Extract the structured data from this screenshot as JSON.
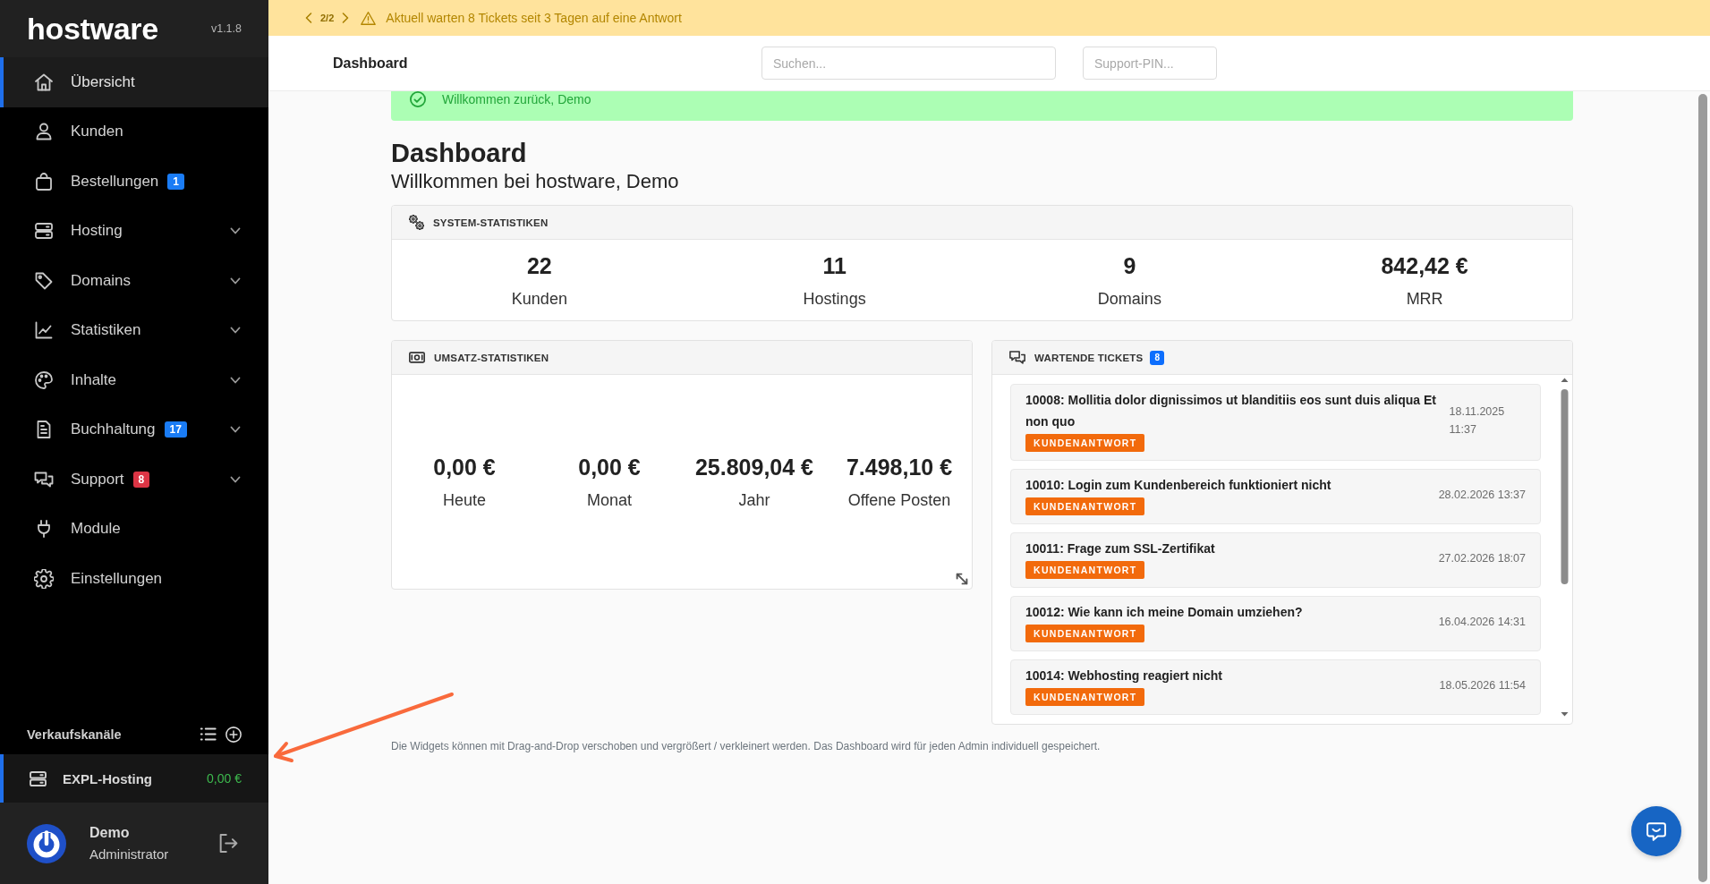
{
  "sidebar": {
    "logo": "hostware",
    "version": "v1.1.8",
    "items": [
      {
        "label": "Übersicht",
        "kind": "link",
        "selected": true
      },
      {
        "label": "Kunden",
        "kind": "link",
        "selected": false
      },
      {
        "label": "Bestellungen",
        "kind": "link",
        "selected": false,
        "badge": {
          "text": "1",
          "color": "#1a7cf5"
        }
      },
      {
        "label": "Hosting",
        "kind": "group",
        "selected": false
      },
      {
        "label": "Domains",
        "kind": "group",
        "selected": false
      },
      {
        "label": "Statistiken",
        "kind": "group",
        "selected": false
      },
      {
        "label": "Inhalte",
        "kind": "group",
        "selected": false
      },
      {
        "label": "Buchhaltung",
        "kind": "group",
        "selected": false,
        "badge": {
          "text": "17",
          "color": "#1a7cf5"
        }
      },
      {
        "label": "Support",
        "kind": "group",
        "selected": false,
        "badge": {
          "text": "8",
          "color": "#dc3545"
        }
      },
      {
        "label": "Module",
        "kind": "link",
        "selected": false
      },
      {
        "label": "Einstellungen",
        "kind": "link",
        "selected": false
      }
    ],
    "sales_channels": {
      "title": "Verkaufskanäle",
      "items": [
        {
          "name": "EXPL-Hosting",
          "amount": "0,00 €",
          "selected": true
        }
      ]
    },
    "user": {
      "name": "Demo",
      "role": "Administrator"
    }
  },
  "notice_bar": {
    "pager": "2/2",
    "text": "Aktuell warten 8 Tickets seit 3 Tagen auf eine Antwort"
  },
  "header": {
    "title": "Dashboard",
    "search": {
      "placeholder": "Suchen..."
    },
    "support_pin": {
      "placeholder": "Support-PIN..."
    }
  },
  "alert": {
    "text": "Willkommen zurück, Demo"
  },
  "page": {
    "title": "Dashboard",
    "subtitle": "Willkommen bei hostware, Demo"
  },
  "system_stats": {
    "title": "SYSTEM-STATISTIKEN",
    "stats": [
      {
        "value": "22",
        "label": "Kunden"
      },
      {
        "value": "11",
        "label": "Hostings"
      },
      {
        "value": "9",
        "label": "Domains"
      },
      {
        "value": "842,42 €",
        "label": "MRR"
      }
    ]
  },
  "revenue_stats": {
    "title": "UMSATZ-STATISTIKEN",
    "stats": [
      {
        "value": "0,00 €",
        "label": "Heute"
      },
      {
        "value": "0,00 €",
        "label": "Monat"
      },
      {
        "value": "25.809,04 €",
        "label": "Jahr"
      },
      {
        "value": "7.498,10 €",
        "label": "Offene Posten"
      }
    ]
  },
  "tickets": {
    "title": "WARTENDE TICKETS",
    "count": "8",
    "items": [
      {
        "title": "10008: Mollitia dolor dignissimos ut blanditiis eos sunt duis aliqua Et non quo",
        "status": "KUNDENANTWORT",
        "date": "18.11.2025 11:37"
      },
      {
        "title": "10010: Login zum Kundenbereich funktioniert nicht",
        "status": "KUNDENANTWORT",
        "date": "28.02.2026 13:37"
      },
      {
        "title": "10011: Frage zum SSL-Zertifikat",
        "status": "KUNDENANTWORT",
        "date": "27.02.2026 18:07"
      },
      {
        "title": "10012: Wie kann ich meine Domain umziehen?",
        "status": "KUNDENANTWORT",
        "date": "16.04.2026 14:31"
      },
      {
        "title": "10014: Webhosting reagiert nicht",
        "status": "KUNDENANTWORT",
        "date": "18.05.2026 11:54"
      }
    ]
  },
  "footer_note": "Die Widgets können mit Drag-and-Drop verschoben und vergrößert / verkleinert werden. Das Dashboard wird für jeden Admin individuell gespeichert."
}
